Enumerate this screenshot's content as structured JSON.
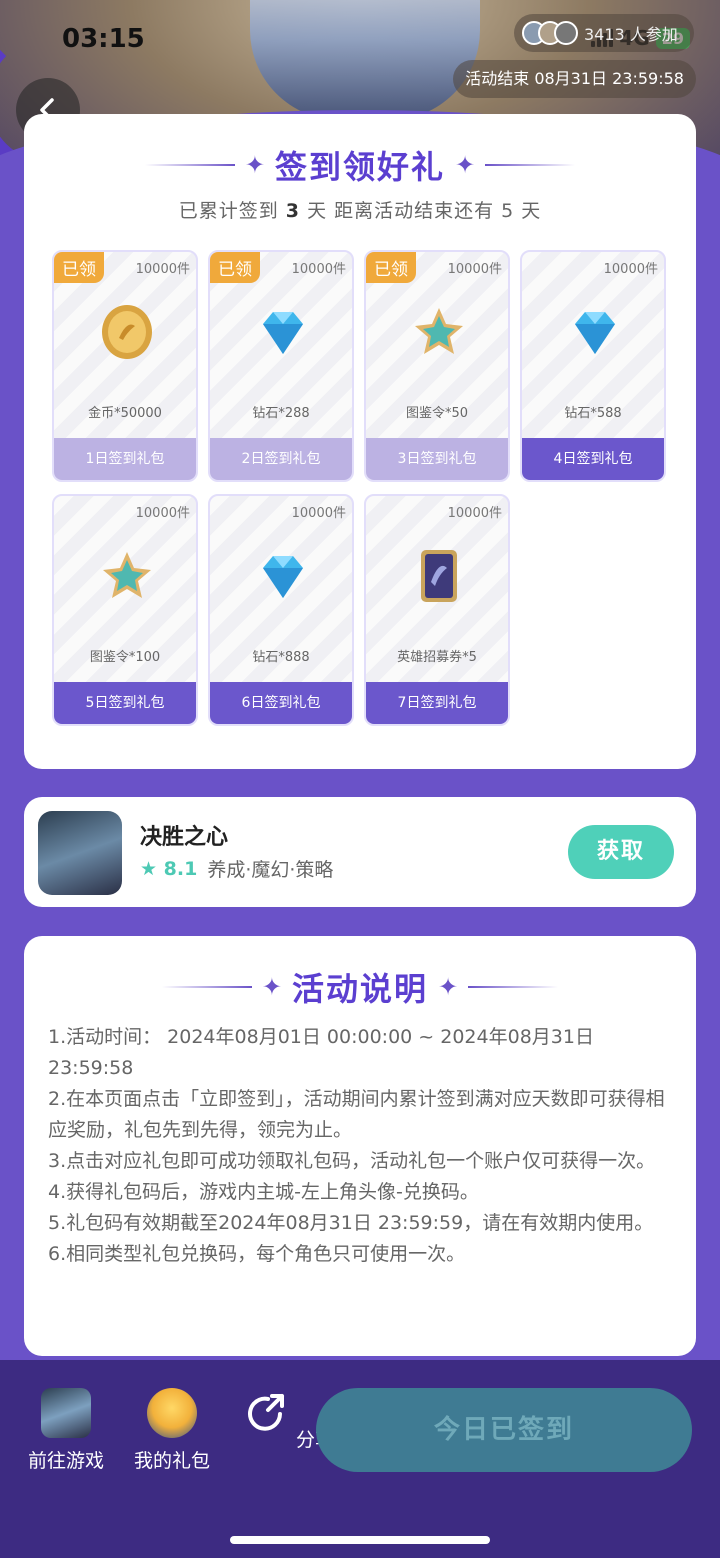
{
  "status_bar": {
    "time": "03:15",
    "network": "4G",
    "battery": "29"
  },
  "header": {
    "participants_text": "3413 人参加",
    "end_badge": "活动结束 08月31日 23:59:58"
  },
  "signin": {
    "title": "签到领好礼",
    "sub_prefix": "已累计签到",
    "days_count": "3",
    "sub_middle": "天  距离活动结束还有 5 天",
    "gifts": [
      {
        "tag": "已领",
        "qty": "10000件",
        "name": "金币*50000",
        "label": "1日签到礼包",
        "icon": "gold-coin-icon"
      },
      {
        "tag": "已领",
        "qty": "10000件",
        "name": "钻石*288",
        "label": "2日签到礼包",
        "icon": "diamond-icon"
      },
      {
        "tag": "已领",
        "qty": "10000件",
        "name": "图鉴令*50",
        "label": "3日签到礼包",
        "icon": "codex-token-icon"
      },
      {
        "tag": "",
        "qty": "10000件",
        "name": "钻石*588",
        "label": "4日签到礼包",
        "icon": "diamond-icon"
      },
      {
        "tag": "",
        "qty": "10000件",
        "name": "图鉴令*100",
        "label": "5日签到礼包",
        "icon": "codex-token-icon"
      },
      {
        "tag": "",
        "qty": "10000件",
        "name": "钻石*888",
        "label": "6日签到礼包",
        "icon": "diamond-icon"
      },
      {
        "tag": "",
        "qty": "10000件",
        "name": "英雄招募券*5",
        "label": "7日签到礼包",
        "icon": "hero-ticket-icon"
      }
    ]
  },
  "game": {
    "name": "决胜之心",
    "rating": "8.1",
    "tags": "养成·魔幻·策略",
    "get_label": "获取"
  },
  "rules": {
    "title": "活动说明",
    "items": [
      "1.活动时间： 2024年08月01日 00:00:00 ~ 2024年08月31日 23:59:58",
      "2.在本页面点击「立即签到」，活动期间内累计签到满对应天数即可获得相应奖励，礼包先到先得，领完为止。",
      "3.点击对应礼包即可成功领取礼包码，活动礼包一个账户仅可获得一次。",
      "4.获得礼包码后，游戏内主城-左上角头像-兑换码。",
      "5.礼包码有效期截至2024年08月31日 23:59:59，请在有效期内使用。",
      "6.相同类型礼包兑换码，每个角色只可使用一次。"
    ]
  },
  "bottom": {
    "go_game": "前往游戏",
    "my_gifts": "我的礼包",
    "share": "分享",
    "checked_in": "今日已签到"
  },
  "colors": {
    "accent": "#6a52c8",
    "claimed_tag": "#f0a93b",
    "get_button": "#4fd0b9"
  }
}
